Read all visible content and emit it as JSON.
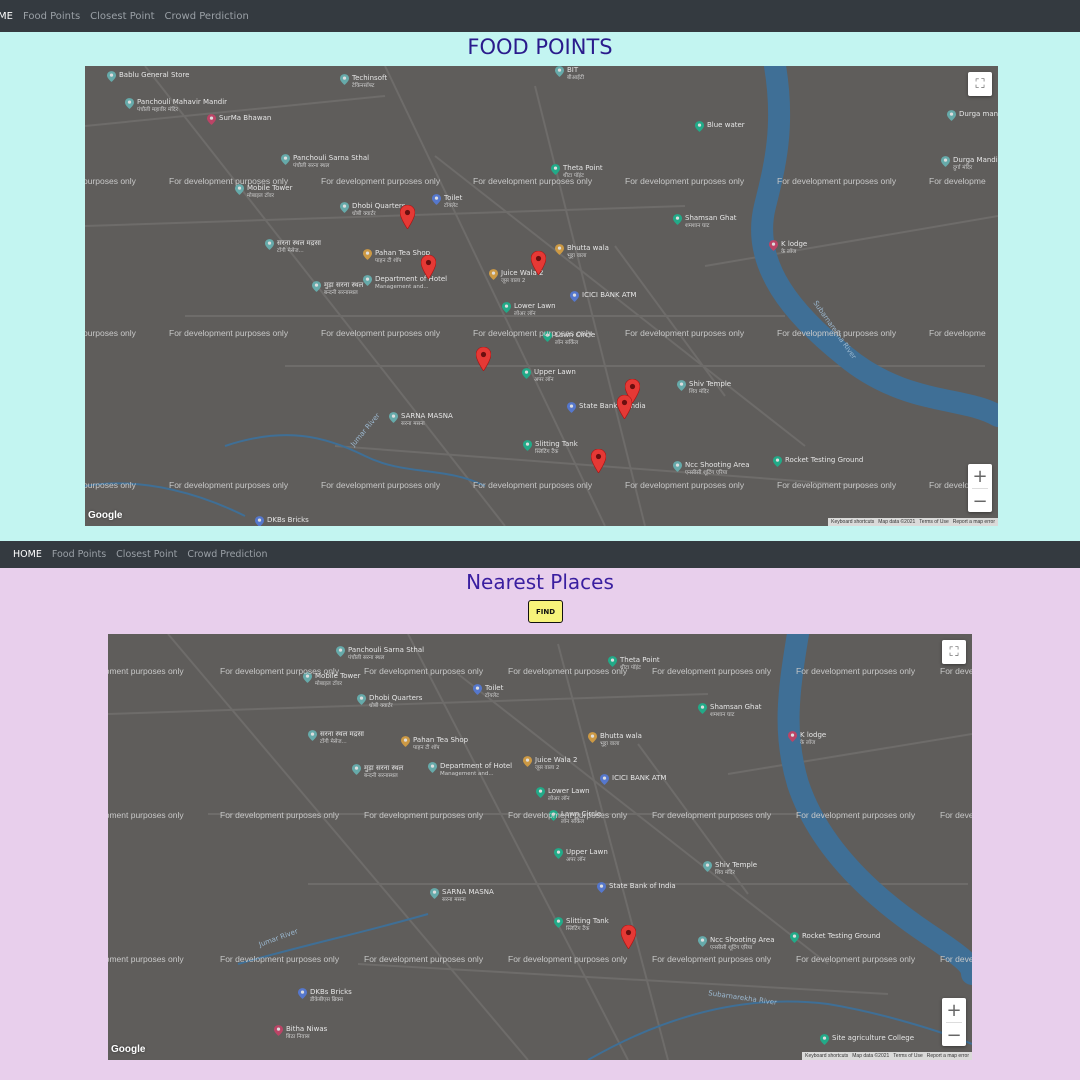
{
  "nav_top": {
    "items": [
      "ME",
      "Food Points",
      "Closest Point",
      "Crowd Perdiction"
    ]
  },
  "nav_bottom": {
    "items": [
      "HOME",
      "Food Points",
      "Closest Point",
      "Crowd Prediction"
    ]
  },
  "section1": {
    "title": "FOOD POINTS"
  },
  "section2": {
    "title": "Nearest Places",
    "find_label": "FIND"
  },
  "map": {
    "watermark": "For development purposes only",
    "watermark_partial": "purposes only",
    "watermark_cut": "For developme",
    "watermark_left2": "opment purposes only",
    "watermark_cut2": "For deve",
    "attribution": {
      "keyboard": "Keyboard shortcuts",
      "data": "Map data ©2021",
      "terms": "Terms of Use",
      "report": "Report a map error"
    },
    "logo": "Google",
    "zoom_in": "+",
    "zoom_out": "−",
    "fullscreen": "⛶",
    "colors": {
      "land": "#5f5d5b",
      "water": "#3f6f96",
      "road": "#6e6c6a",
      "marker": "#e53935"
    }
  },
  "places1": [
    {
      "name": "Bablu General Store",
      "sub": ""
    },
    {
      "name": "Techinsoft",
      "sub": "टेकिनसॉफ्ट"
    },
    {
      "name": "BIT",
      "sub": "बीआईटी"
    },
    {
      "name": "Panchouli Mahavir Mandir",
      "sub": "पंचौली महावीर मंदिर"
    },
    {
      "name": "SurMa Bhawan",
      "sub": ""
    },
    {
      "name": "Blue water",
      "sub": ""
    },
    {
      "name": "Durga mand",
      "sub": ""
    },
    {
      "name": "Panchouli Sarna Sthal",
      "sub": "पंचौली सरना स्थल"
    },
    {
      "name": "Durga Mandir",
      "sub": "दुर्गा मंदिर"
    },
    {
      "name": "Theta Point",
      "sub": "थीटा पॉइंट"
    },
    {
      "name": "Mobile Tower",
      "sub": "मोबाइल टॉवर"
    },
    {
      "name": "Toilet",
      "sub": "टॉयलेट"
    },
    {
      "name": "Dhobi Quarters",
      "sub": "धोबी क्वार्टर"
    },
    {
      "name": "Shamsan Ghat",
      "sub": "शमशान घाट"
    },
    {
      "name": "सरना स्थल मद्रसा",
      "sub": "टोंगी मेसेज..."
    },
    {
      "name": "Pahan Tea Shop",
      "sub": "पाहन टी शॉप"
    },
    {
      "name": "Bhutta wala",
      "sub": "भुट्टा वाला"
    },
    {
      "name": "K lodge",
      "sub": "के लॉज"
    },
    {
      "name": "Juice Wala 2",
      "sub": "जूस वाला 2"
    },
    {
      "name": "Department of Hotel",
      "sub": "Management and..."
    },
    {
      "name": "मुड़ा सरना स्थल",
      "sub": "बन्दनी सरनास्थल"
    },
    {
      "name": "ICICI BANK ATM",
      "sub": ""
    },
    {
      "name": "Lower Lawn",
      "sub": "लोअर लॉन"
    },
    {
      "name": "Lawn Circle",
      "sub": "लॉन सर्किल"
    },
    {
      "name": "Upper Lawn",
      "sub": "अपर लॉन"
    },
    {
      "name": "Shiv Temple",
      "sub": "शिव मंदिर"
    },
    {
      "name": "SARNA MASNA",
      "sub": "सरना मसना"
    },
    {
      "name": "State Bank of India",
      "sub": ""
    },
    {
      "name": "Slitting Tank",
      "sub": "स्लिटिंग टैंक"
    },
    {
      "name": "Ncc Shooting Area",
      "sub": "एनसीसी शूटिंग एरिया"
    },
    {
      "name": "Rocket Testing Ground",
      "sub": ""
    },
    {
      "name": "DKBs Bricks",
      "sub": ""
    },
    {
      "name": "Jumar River",
      "sub": ""
    },
    {
      "name": "Subarnarekha River",
      "sub": ""
    }
  ],
  "places2": [
    {
      "name": "Panchouli Sarna Sthal",
      "sub": "पंचौली सरना स्थल"
    },
    {
      "name": "Theta Point",
      "sub": "थीटा पॉइंट"
    },
    {
      "name": "Mobile Tower",
      "sub": "मोबाइल टॉवर"
    },
    {
      "name": "Toilet",
      "sub": "टॉयलेट"
    },
    {
      "name": "Dhobi Quarters",
      "sub": "धोबी क्वार्टर"
    },
    {
      "name": "Shamsan Ghat",
      "sub": "शमशान घाट"
    },
    {
      "name": "सरना स्थल मद्रसा",
      "sub": "टोंगी मेसेज..."
    },
    {
      "name": "Pahan Tea Shop",
      "sub": "पाहन टी शॉप"
    },
    {
      "name": "Bhutta wala",
      "sub": "भुट्टा वाला"
    },
    {
      "name": "K lodge",
      "sub": "के लॉज"
    },
    {
      "name": "Juice Wala 2",
      "sub": "जूस वाला 2"
    },
    {
      "name": "Department of Hotel",
      "sub": "Management and..."
    },
    {
      "name": "मुड़ा सरना स्थल",
      "sub": "बन्दनी सरनास्थल"
    },
    {
      "name": "ICICI BANK ATM",
      "sub": ""
    },
    {
      "name": "Lower Lawn",
      "sub": "लोअर लॉन"
    },
    {
      "name": "Lawn Circle",
      "sub": "लॉन सर्किल"
    },
    {
      "name": "Upper Lawn",
      "sub": "अपर लॉन"
    },
    {
      "name": "Shiv Temple",
      "sub": "शिव मंदिर"
    },
    {
      "name": "SARNA MASNA",
      "sub": "सरना मसना"
    },
    {
      "name": "State Bank of India",
      "sub": ""
    },
    {
      "name": "Slitting Tank",
      "sub": "स्लिटिंग टैंक"
    },
    {
      "name": "Ncc Shooting Area",
      "sub": "एनसीसी शूटिंग एरिया"
    },
    {
      "name": "Rocket Testing Ground",
      "sub": ""
    },
    {
      "name": "DKBs Bricks",
      "sub": "डीकेबीएस ब्रिक्स"
    },
    {
      "name": "Bitha Niwas",
      "sub": "बिठा निवास"
    },
    {
      "name": "Site agriculture College",
      "sub": ""
    },
    {
      "name": "Jumar River",
      "sub": ""
    },
    {
      "name": "Subarnarekha River",
      "sub": ""
    }
  ]
}
